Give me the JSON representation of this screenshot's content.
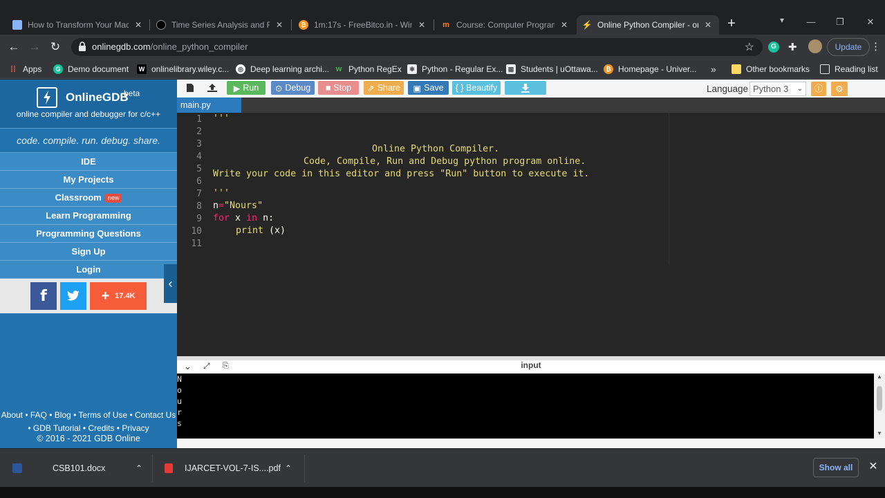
{
  "browser": {
    "tabs": [
      {
        "title": "How to Transform Your Mach",
        "icon": "page-icon",
        "color": "#8ab4f8"
      },
      {
        "title": "Time Series Analysis and Fore",
        "icon": "github-icon",
        "color": "#000000"
      },
      {
        "title": "1m:17s - FreeBitco.in - Win f",
        "icon": "bitcoin-icon",
        "color": "#f7931a"
      },
      {
        "title": "Course: Computer Programm",
        "icon": "moodle-icon",
        "color": "#f98012"
      },
      {
        "title": "Online Python Compiler - on",
        "icon": "onlinegdb-icon",
        "color": "#4a6ee0"
      }
    ],
    "url_host": "onlinegdb.com",
    "url_path": "/online_python_compiler",
    "update_label": "Update",
    "bookmarks": [
      {
        "label": "Apps",
        "icon": "apps-grid-icon"
      },
      {
        "label": "Demo document",
        "icon": "grammarly-icon"
      },
      {
        "label": "onlinelibrary.wiley.c...",
        "icon": "wiley-icon"
      },
      {
        "label": "Deep learning archi...",
        "icon": "globe-icon"
      },
      {
        "label": "Python RegEx",
        "icon": "w3schools-icon"
      },
      {
        "label": "Python - Regular Ex...",
        "icon": "tutorialspoint-icon"
      },
      {
        "label": "Students | uOttawa...",
        "icon": "uottawa-icon"
      },
      {
        "label": "Homepage - Univer...",
        "icon": "bitcoin-icon"
      }
    ],
    "overflow_label": "»",
    "other_bookmarks": "Other bookmarks",
    "reading_list": "Reading list"
  },
  "sidebar": {
    "brand": "OnlineGDB",
    "beta": "beta",
    "subtitle": "online compiler and debugger for c/c++",
    "tagline": "code. compile. run. debug. share.",
    "nav": [
      {
        "label": "IDE"
      },
      {
        "label": "My Projects"
      },
      {
        "label": "Classroom",
        "badge": "new"
      },
      {
        "label": "Learn Programming"
      },
      {
        "label": "Programming Questions"
      },
      {
        "label": "Sign Up"
      },
      {
        "label": "Login"
      }
    ],
    "share_count": "17.4K",
    "footer_line1": "About • FAQ • Blog • Terms of Use • Contact Us",
    "footer_line2": "• GDB Tutorial • Credits • Privacy",
    "copyright": "© 2016 - 2021 GDB Online"
  },
  "toolbar": {
    "run": "Run",
    "debug": "Debug",
    "stop": "Stop",
    "share": "Share",
    "save": "Save",
    "beautify": "{ } Beautify",
    "language_label": "Language",
    "language_value": "Python 3"
  },
  "file_tab": "main.py",
  "editor": {
    "lines": [
      "1",
      "2",
      "3",
      "4",
      "5",
      "6",
      "7",
      "8",
      "9",
      "10",
      "11"
    ],
    "code": {
      "l1": "'''",
      "l3": "Online Python Compiler.",
      "l4": "Code, Compile, Run and Debug python program online.",
      "l5": "Write your code in this editor and press \"Run\" button to execute it.",
      "l7": "'''",
      "l8_var": "n",
      "l8_eq": "=",
      "l8_str": "\"Nours\"",
      "l9_for": "for",
      "l9_x": " x ",
      "l9_in": "in",
      "l9_n": " n:",
      "l10_print": "print",
      "l10_args": " (x)"
    }
  },
  "output": {
    "label": "input",
    "lines": [
      "N",
      "o",
      "u",
      "r",
      "s"
    ]
  },
  "downloads": {
    "items": [
      {
        "name": "CSB101.docx",
        "icon": "word-doc-icon"
      },
      {
        "name": "IJARCET-VOL-7-IS....pdf",
        "icon": "pdf-icon"
      }
    ],
    "show_all": "Show all"
  }
}
